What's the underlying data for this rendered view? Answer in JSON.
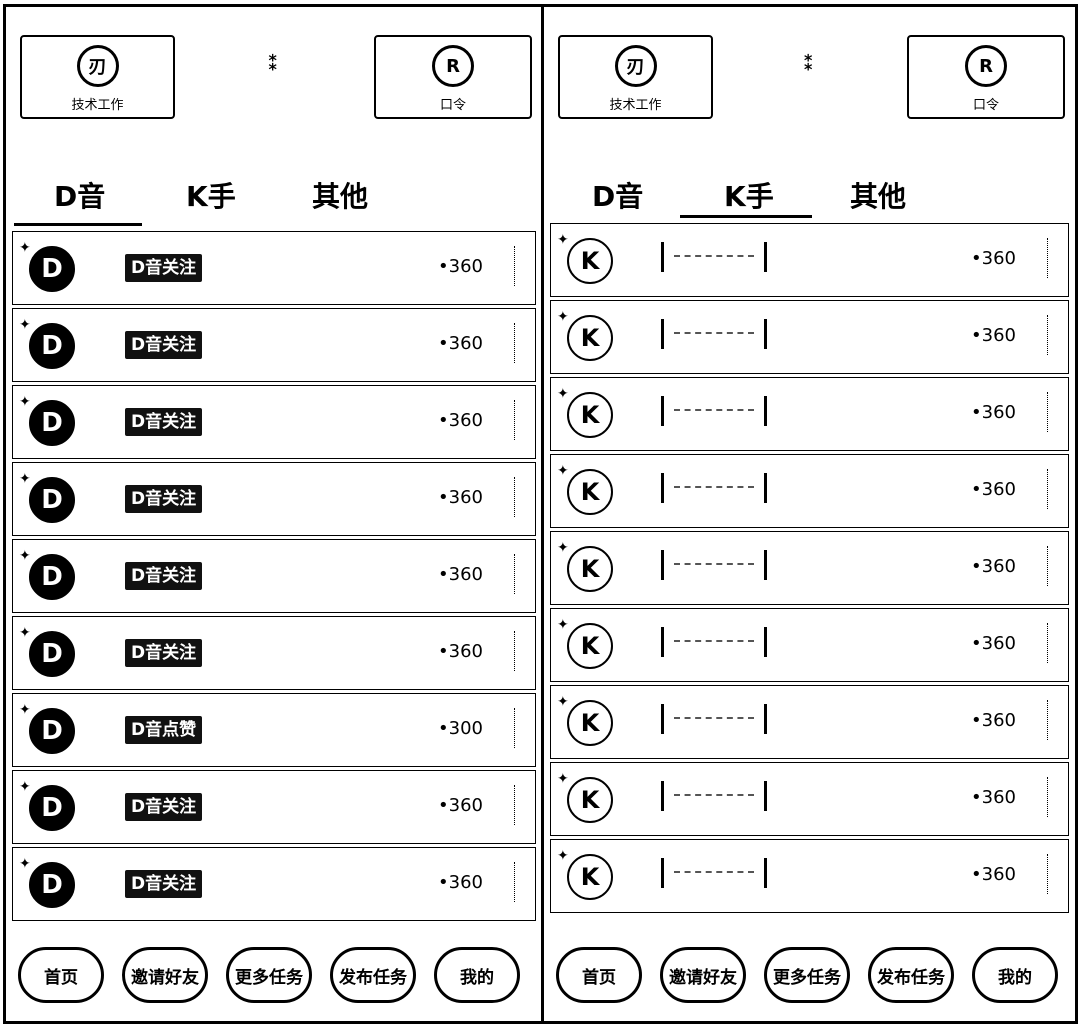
{
  "left": {
    "cards": [
      {
        "icon_glyph": "刃",
        "label": "技术工作"
      },
      {
        "icon_glyph": "⁑",
        "label": ""
      },
      {
        "icon_glyph": "R",
        "label": "口令"
      }
    ],
    "tabs": [
      {
        "label": "D音",
        "active": true
      },
      {
        "label": "K手",
        "active": false
      },
      {
        "label": "其他",
        "active": false
      }
    ],
    "rows": [
      {
        "logo": "D",
        "badge": "D音关注",
        "price": "•360"
      },
      {
        "logo": "D",
        "badge": "D音关注",
        "price": "•360"
      },
      {
        "logo": "D",
        "badge": "D音关注",
        "price": "•360"
      },
      {
        "logo": "D",
        "badge": "D音关注",
        "price": "•360"
      },
      {
        "logo": "D",
        "badge": "D音关注",
        "price": "•360"
      },
      {
        "logo": "D",
        "badge": "D音关注",
        "price": "•360"
      },
      {
        "logo": "D",
        "badge": "D音点赞",
        "price": "•300"
      },
      {
        "logo": "D",
        "badge": "D音关注",
        "price": "•360"
      },
      {
        "logo": "D",
        "badge": "D音关注",
        "price": "•360"
      }
    ],
    "nav": [
      "首页",
      "邀请好友",
      "更多任务",
      "发布任务",
      "我的"
    ]
  },
  "right": {
    "cards": [
      {
        "icon_glyph": "刃",
        "label": "技术工作"
      },
      {
        "icon_glyph": "⁑",
        "label": ""
      },
      {
        "icon_glyph": "R",
        "label": "口令"
      }
    ],
    "tabs": [
      {
        "label": "D音",
        "active": false
      },
      {
        "label": "K手",
        "active": true
      },
      {
        "label": "其他",
        "active": false
      }
    ],
    "rows": [
      {
        "logo": "K",
        "price": "•360"
      },
      {
        "logo": "K",
        "price": "•360"
      },
      {
        "logo": "K",
        "price": "•360"
      },
      {
        "logo": "K",
        "price": "•360"
      },
      {
        "logo": "K",
        "price": "•360"
      },
      {
        "logo": "K",
        "price": "•360"
      },
      {
        "logo": "K",
        "price": "•360"
      },
      {
        "logo": "K",
        "price": "•360"
      },
      {
        "logo": "K",
        "price": "•360"
      }
    ],
    "nav": [
      "首页",
      "邀请好友",
      "更多任务",
      "发布任务",
      "我的"
    ]
  }
}
